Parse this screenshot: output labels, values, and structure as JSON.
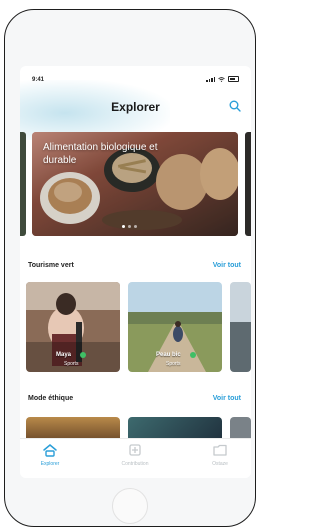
{
  "status": {
    "time": "9:41"
  },
  "header": {
    "title": "Explorer"
  },
  "hero": {
    "text": "Alimentation biologique et durable",
    "dots": 3,
    "active_dot": 1
  },
  "sections": [
    {
      "title": "Tourisme vert",
      "link": "Voir tout",
      "cards": [
        {
          "label": "Maya",
          "sub": "Sports"
        },
        {
          "label": "Peau bic",
          "sub": "Sports"
        }
      ]
    },
    {
      "title": "Mode éthique",
      "link": "Voir tout"
    }
  ],
  "tabbar": {
    "items": [
      {
        "label": "Explorer",
        "icon": "explore-icon",
        "active": true
      },
      {
        "label": "Contribution",
        "icon": "contribution-icon",
        "active": false
      },
      {
        "label": "Ostaze",
        "icon": "folder-icon",
        "active": false
      }
    ]
  },
  "colors": {
    "accent": "#2a9ed8",
    "badge": "#3fbf65"
  }
}
